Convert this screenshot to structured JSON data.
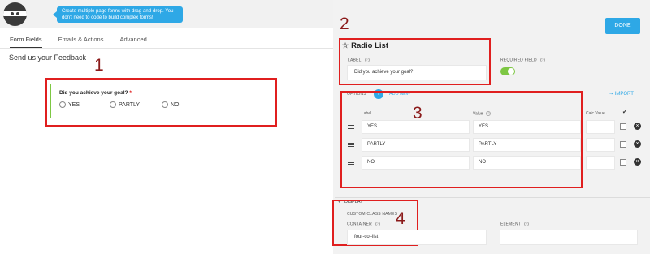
{
  "tooltip": {
    "line1": "Create multiple page forms with drag-and-drop. You",
    "line2": "don't need to code to build complex forms!"
  },
  "tabs": [
    {
      "label": "Form Fields",
      "active": true
    },
    {
      "label": "Emails & Actions",
      "active": false
    },
    {
      "label": "Advanced",
      "active": false
    }
  ],
  "page_title": "Send us your Feedback",
  "preview": {
    "question": "Did you achieve your goal?",
    "required_mark": "*",
    "options": [
      "YES",
      "PARTLY",
      "NO"
    ]
  },
  "annotations": {
    "n1": "1",
    "n2": "2",
    "n3": "3",
    "n4": "4"
  },
  "panel": {
    "done_label": "DONE",
    "field_title": "Radio List",
    "label_caption": "LABEL",
    "label_value": "Did you achieve your goal?",
    "required_caption": "REQUIRED FIELD",
    "required_on": true,
    "options_caption": "OPTIONS",
    "add_new": "ADD NEW",
    "import": "IMPORT",
    "col_label": "Label",
    "col_value": "Value",
    "col_calc": "Calc Value",
    "col_check": "✔",
    "rows": [
      {
        "label": "YES",
        "value": "YES"
      },
      {
        "label": "PARTLY",
        "value": "PARTLY"
      },
      {
        "label": "NO",
        "value": "NO"
      }
    ],
    "display_caption": "DISPLAY",
    "custom_class_caption": "CUSTOM CLASS NAMES",
    "container_caption": "CONTAINER",
    "container_value": "four-col-list",
    "element_caption": "ELEMENT",
    "element_value": ""
  },
  "colors": {
    "accent": "#2ea8e6",
    "annotation_red": "#e01f1f",
    "success_green": "#7dc743"
  }
}
